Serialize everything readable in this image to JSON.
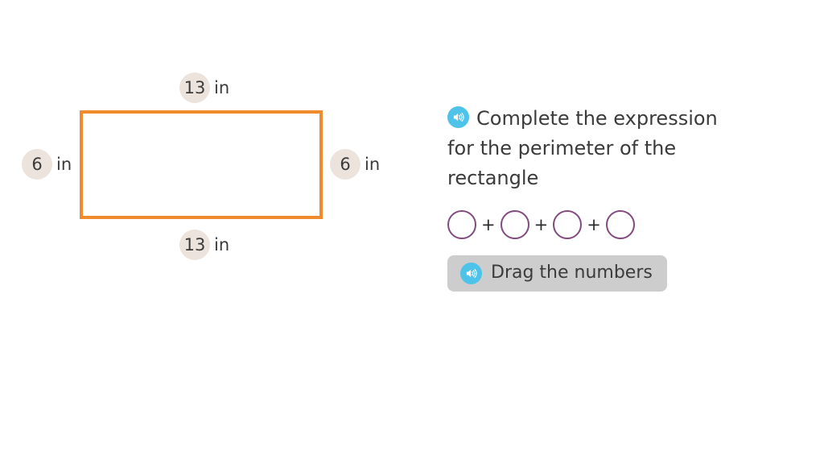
{
  "figure": {
    "shape": "rectangle",
    "outline_color": "#ef8b2c",
    "labels": {
      "top": {
        "value": "13",
        "unit": "in"
      },
      "bottom": {
        "value": "13",
        "unit": "in"
      },
      "left": {
        "value": "6",
        "unit": "in"
      },
      "right": {
        "value": "6",
        "unit": "in"
      }
    }
  },
  "question": {
    "audio_icon": "speaker-icon",
    "prompt": "Complete the expression for the perimeter of the rectangle",
    "expression": {
      "blank_count": 4,
      "blank_value": "",
      "operators": [
        "+",
        "+",
        "+"
      ],
      "blank_outline_color": "#834a7f"
    },
    "drag_button": {
      "label": "Drag the numbers",
      "audio_icon": "speaker-icon",
      "background": "#cdcdcd"
    }
  },
  "theme": {
    "background": "#ffffff",
    "text_color": "#3b3b3b",
    "badge_color": "#ece3dc",
    "audio_accent": "#4ec3e9"
  }
}
